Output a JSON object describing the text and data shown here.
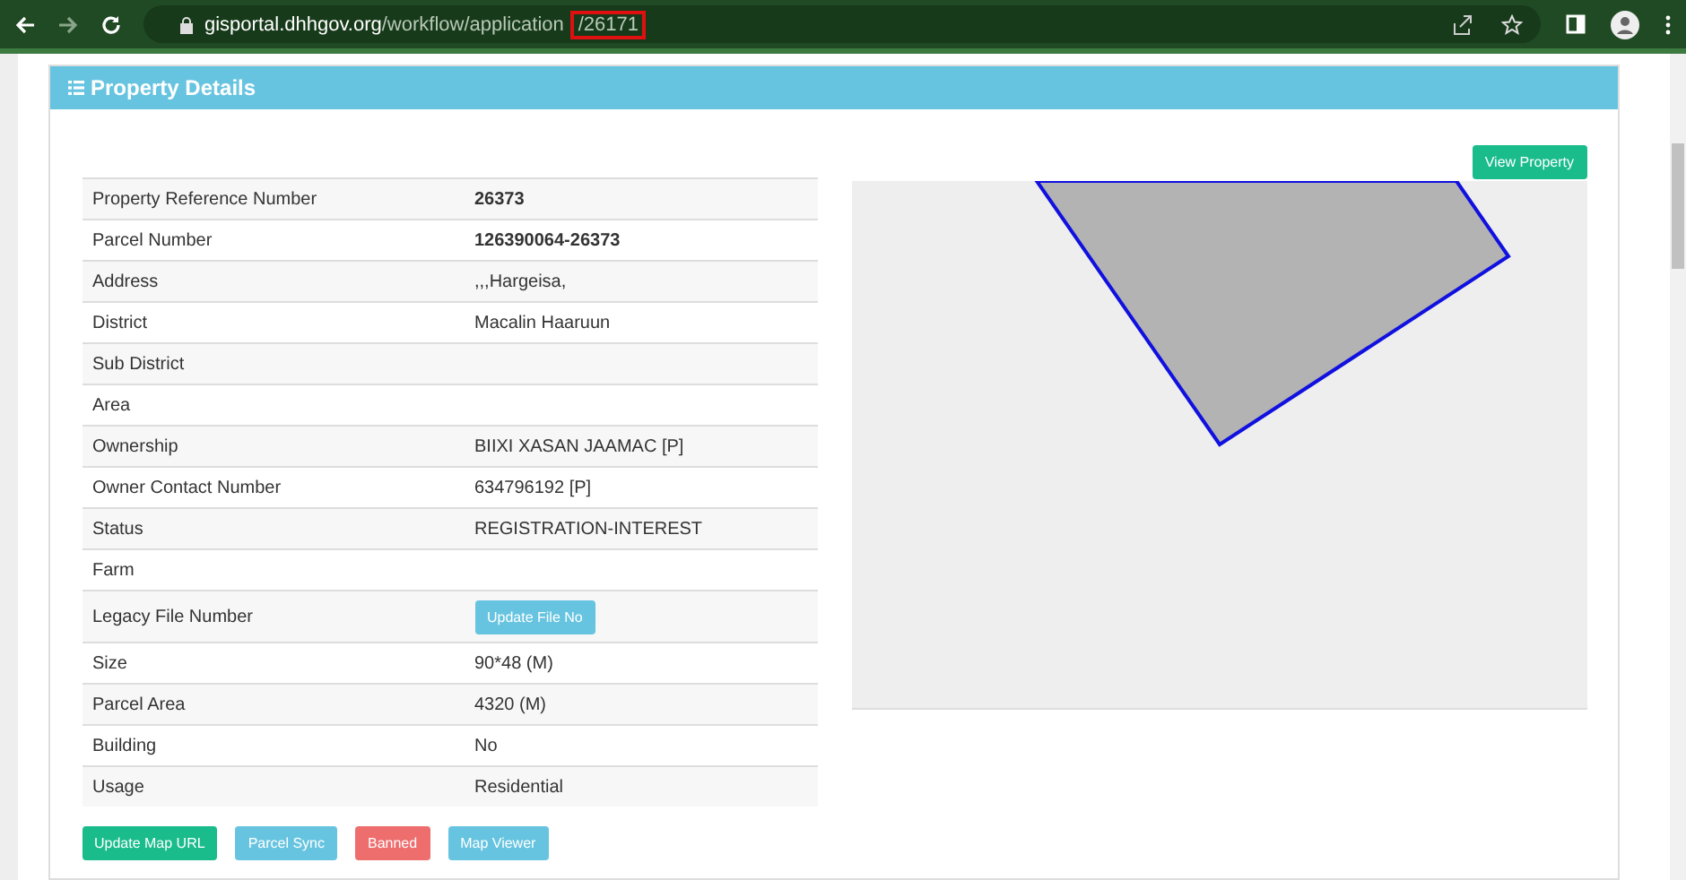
{
  "browser": {
    "url_host": "gisportal.dhhgov.org",
    "url_path": "/workflow/application",
    "url_highlight": "/26171"
  },
  "panel": {
    "title": "Property Details",
    "view_button": "View Property"
  },
  "rows": [
    {
      "label": "Property Reference Number",
      "value": "26373",
      "kind": "bold"
    },
    {
      "label": "Parcel Number",
      "value": "126390064-26373",
      "kind": "bold"
    },
    {
      "label": "Address",
      "value": ",,,Hargeisa,",
      "kind": "text"
    },
    {
      "label": "District",
      "value": "Macalin Haaruun",
      "kind": "text"
    },
    {
      "label": "Sub District",
      "kind": "text"
    },
    {
      "label": "Area",
      "kind": "text"
    },
    {
      "label": "Ownership",
      "value": "BIIXI XASAN JAAMAC [P]",
      "kind": "text"
    },
    {
      "label": "Owner Contact Number",
      "value": "634796192 [P]",
      "kind": "text"
    },
    {
      "label": "Status",
      "value": "REGISTRATION-INTEREST",
      "kind": "text"
    },
    {
      "label": "Farm",
      "kind": "text"
    },
    {
      "label": "Legacy File Number",
      "value": "Update File No",
      "kind": "button"
    },
    {
      "label": "Size",
      "value": "90*48 (M)",
      "kind": "text"
    },
    {
      "label": "Parcel Area",
      "value": "4320 (M)",
      "kind": "text"
    },
    {
      "label": "Building",
      "value": "No",
      "kind": "text"
    },
    {
      "label": "Usage",
      "value": "Residential",
      "kind": "text"
    }
  ],
  "actions": [
    {
      "label": "Update Map URL",
      "color": "#1abc8c"
    },
    {
      "label": "Parcel Sync",
      "color": "#67c4e0"
    },
    {
      "label": "Banned",
      "color": "#ee6e6e"
    },
    {
      "label": "Map Viewer",
      "color": "#67c4e0"
    }
  ]
}
